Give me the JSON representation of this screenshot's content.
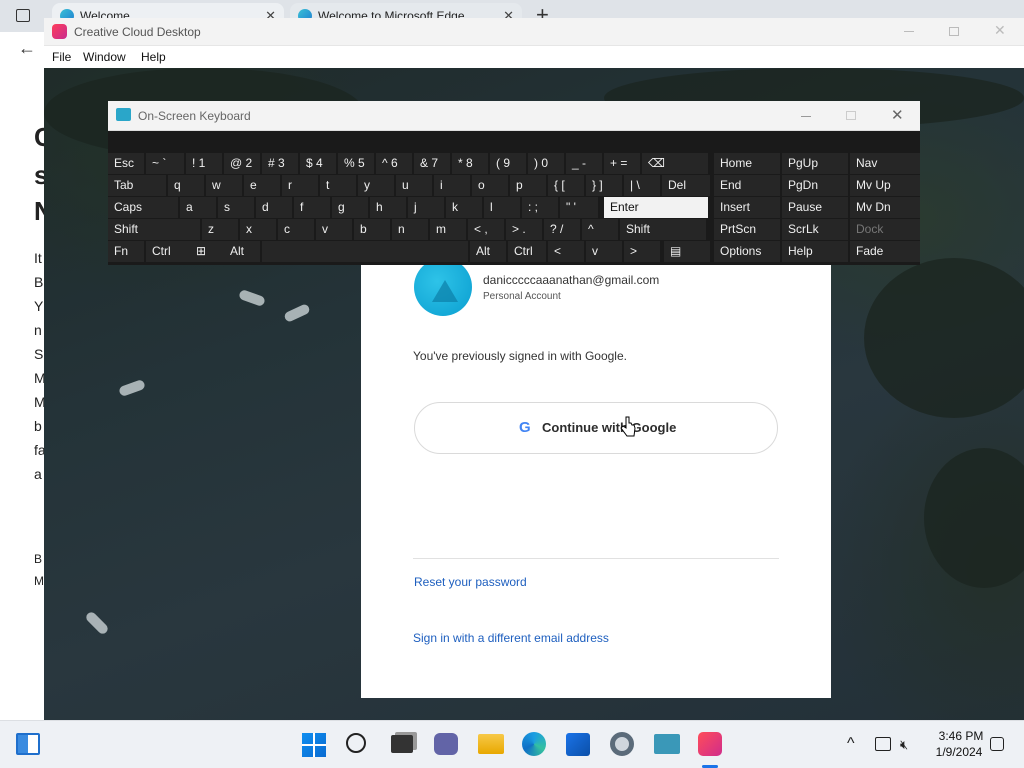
{
  "edge": {
    "tabs": [
      {
        "title": "Welcome"
      },
      {
        "title": "Welcome to Microsoft Edge"
      }
    ],
    "new_tab": "+",
    "side_text": [
      "C",
      "s",
      "N",
      "It",
      "B",
      "Y",
      "n",
      "S",
      "M",
      "M",
      "b",
      "fa",
      "a",
      "B",
      "M"
    ]
  },
  "cc_window": {
    "title": "Creative Cloud Desktop",
    "menu": [
      "File",
      "Window",
      "Help"
    ],
    "signin": {
      "email": "danicccccaaanathan@gmail.com",
      "account_type": "Personal Account",
      "message": "You've previously signed in with Google.",
      "google_button": "Continue with Google",
      "reset_link": "Reset your password",
      "different_email_link": "Sign in with a different email address"
    }
  },
  "osk": {
    "title": "On-Screen Keyboard",
    "rows": [
      [
        "Esc",
        "~ `",
        "! 1",
        "@ 2",
        "# 3",
        "$ 4",
        "% 5",
        "^ 6",
        "& 7",
        "* 8",
        "( 9",
        ") 0",
        "_ -",
        "+ =",
        "⌫",
        "Home",
        "PgUp",
        "Nav"
      ],
      [
        "Tab",
        "q",
        "w",
        "e",
        "r",
        "t",
        "y",
        "u",
        "i",
        "o",
        "p",
        "{ [",
        "} ]",
        "| \\",
        "Del",
        "End",
        "PgDn",
        "Mv Up"
      ],
      [
        "Caps",
        "a",
        "s",
        "d",
        "f",
        "g",
        "h",
        "j",
        "k",
        "l",
        ": ;",
        "\" '",
        "Enter",
        "Insert",
        "Pause",
        "Mv Dn"
      ],
      [
        "Shift",
        "z",
        "x",
        "c",
        "v",
        "b",
        "n",
        "m",
        "< ,",
        "> .",
        "? /",
        "^",
        "Shift",
        "PrtScn",
        "ScrLk",
        "Dock"
      ],
      [
        "Fn",
        "Ctrl",
        "⊞",
        "Alt",
        "Alt",
        "Ctrl",
        "<",
        "v",
        ">",
        "▤",
        "Options",
        "Help",
        "Fade"
      ]
    ]
  },
  "taskbar": {
    "time": "3:46 PM",
    "date": "1/9/2024",
    "chevron": "^",
    "icons": [
      "widgets-icon",
      "start-icon",
      "search-icon",
      "task-view-icon",
      "teams-chat-icon",
      "file-explorer-icon",
      "edge-icon",
      "store-icon",
      "settings-icon",
      "osk-icon",
      "creative-cloud-icon"
    ]
  }
}
